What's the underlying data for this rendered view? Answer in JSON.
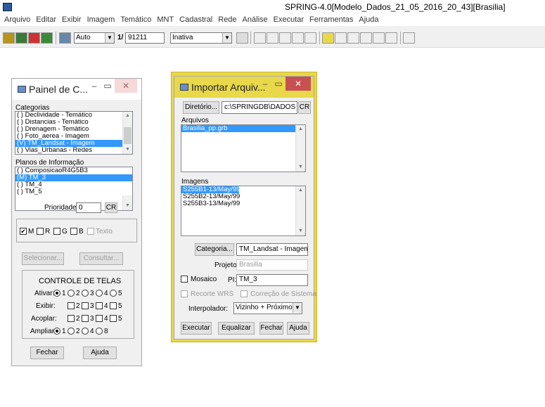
{
  "app": {
    "title": "SPRING-4.0[Modelo_Dados_21_05_2016_20_43][Brasilia]",
    "menu": [
      "Arquivo",
      "Editar",
      "Exibir",
      "Imagem",
      "Temático",
      "MNT",
      "Cadastral",
      "Rede",
      "Análise",
      "Executar",
      "Ferramentas",
      "Ajuda"
    ]
  },
  "toolbar": {
    "zoom_mode": "Auto",
    "scale_prefix": "1/",
    "scale_value": "91211",
    "cursor_mode": "Inativa"
  },
  "painel": {
    "title": "Painel de C...",
    "categorias_label": "Categorias",
    "categorias": [
      {
        "text": "( ) Declividade - Temático",
        "selected": false
      },
      {
        "text": "( ) Distancias - Temático",
        "selected": false
      },
      {
        "text": "( ) Drenagem - Temático",
        "selected": false
      },
      {
        "text": "( ) Foto_aerea - Imagem",
        "selected": false
      },
      {
        "text": "(V) TM_Landsat - Imagem",
        "selected": true
      },
      {
        "text": "( ) Vias_Urbanas - Redes",
        "selected": false
      }
    ],
    "planos_label": "Planos de Informação",
    "planos": [
      {
        "text": "( ) ComposicaoR4G5B3",
        "selected": false
      },
      {
        "text": "(M) TM_3",
        "selected": true
      },
      {
        "text": "( ) TM_4",
        "selected": false
      },
      {
        "text": "( ) TM_5",
        "selected": false
      }
    ],
    "prioridade_label": "Prioridade:",
    "prioridade_value": "0",
    "cr_label": "CR",
    "channels": [
      "M",
      "R",
      "G",
      "B",
      "Texto"
    ],
    "selecionar": "Selecionar...",
    "consultar": "Consultar...",
    "controle_title": "CONTROLE DE TELAS",
    "ativar_label": "Ativar:",
    "exibir_label": "Exibir:",
    "acoplar_label": "Acoplar:",
    "ampliar_label": "Ampliar:",
    "screens": [
      "1",
      "2",
      "3",
      "4",
      "5"
    ],
    "ampliar_opts": [
      "1",
      "2",
      "4",
      "8"
    ],
    "fechar": "Fechar",
    "ajuda": "Ajuda"
  },
  "importar": {
    "title": "Importar Arquiv...",
    "diretorio_btn": "Diretório...",
    "diretorio_value": "c:\\SPRINGDB\\DADOS",
    "cr_label": "CR",
    "arquivos_label": "Arquivos",
    "arquivos": [
      {
        "text": "Brasilia_pp.grb",
        "selected": true
      }
    ],
    "imagens_label": "Imagens",
    "imagens": [
      {
        "text": "S255B1-13/May/99",
        "selected": true
      },
      {
        "text": "S255B2-13/May/99",
        "selected": false
      },
      {
        "text": "S255B3-13/May/99",
        "selected": false
      }
    ],
    "categoria_btn": "Categoria...",
    "categoria_value": "TM_Landsat - Imagem",
    "projeto_label": "Projeto:",
    "projeto_value": "Brasilia",
    "mosaico_label": "Mosaico",
    "pi_label": "PI:",
    "pi_value": "TM_3",
    "recorte_label": "Recorte WRS",
    "correcao_label": "Correção de Sistema",
    "interpolador_label": "Interpolador:",
    "interpolador_value": "Vizinho + Próximo",
    "executar": "Executar",
    "equalizar": "Equalizar",
    "fechar": "Fechar",
    "ajuda": "Ajuda"
  },
  "colors": {
    "selection": "#3399ff",
    "close": "#c75050",
    "accent_yellow": "#e8d84a"
  }
}
